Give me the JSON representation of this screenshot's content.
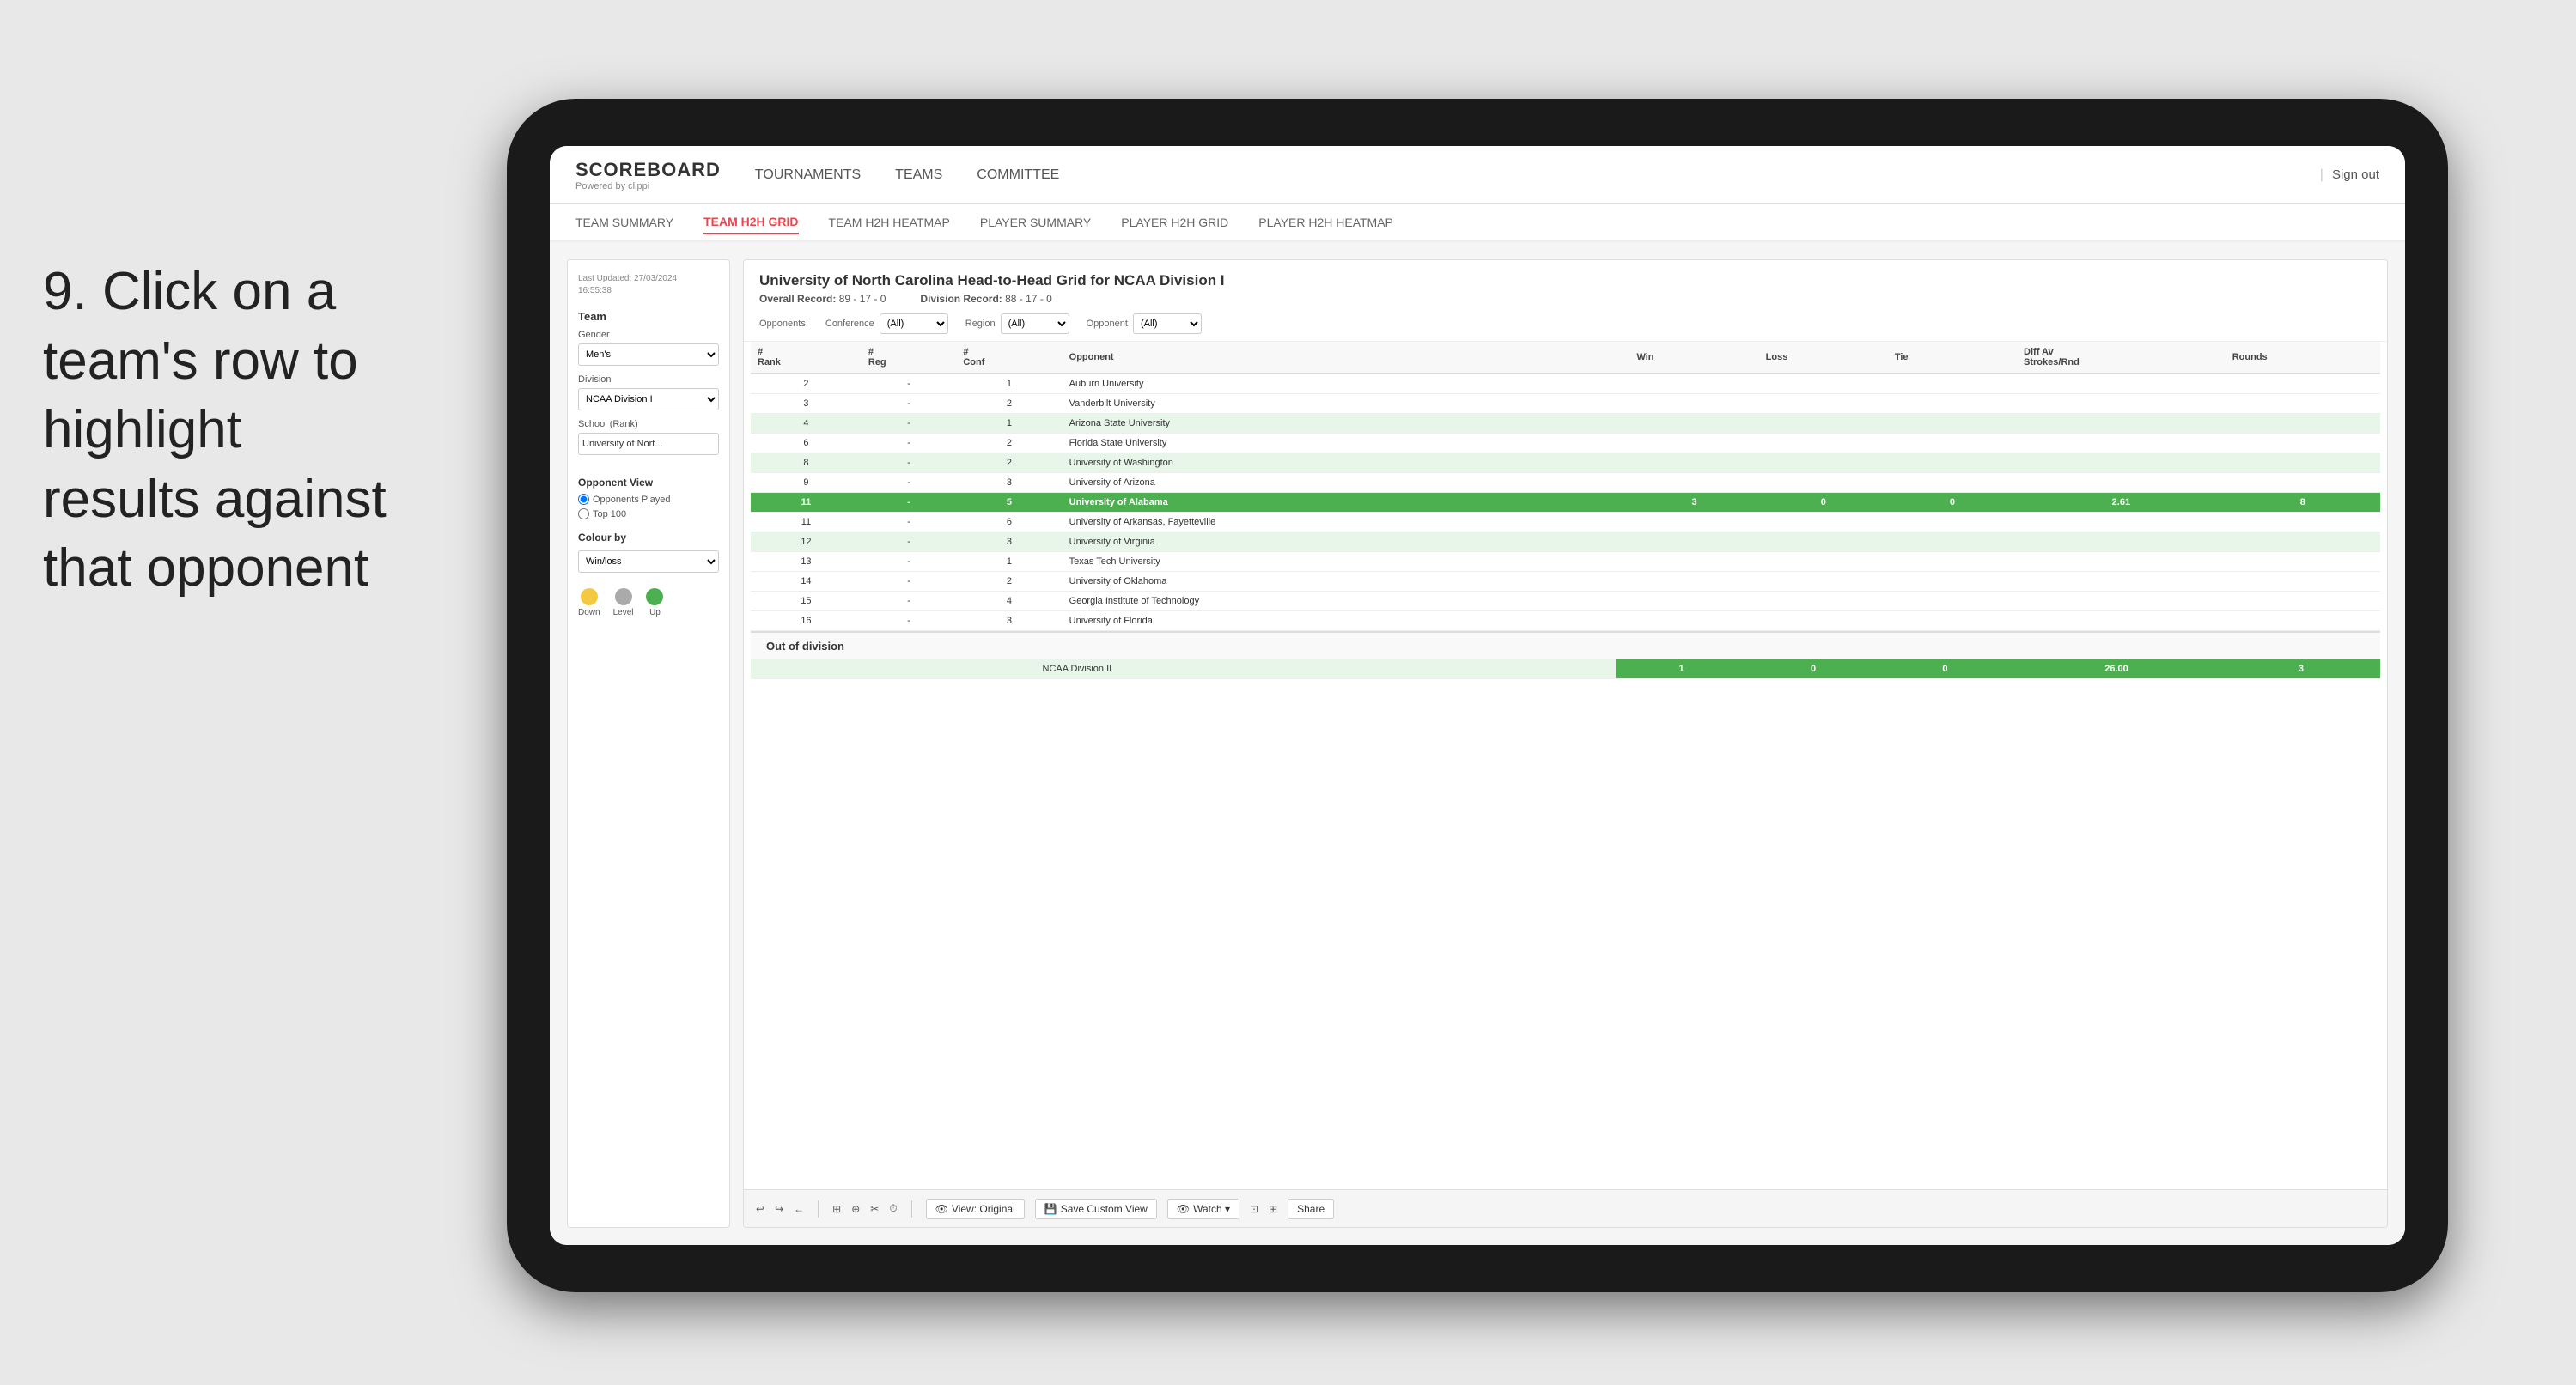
{
  "instruction": {
    "step": "9.",
    "text": "Click on a team's row to highlight results against that opponent"
  },
  "nav": {
    "logo": "SCOREBOARD",
    "logo_sub": "Powered by clippi",
    "items": [
      "TOURNAMENTS",
      "TEAMS",
      "COMMITTEE"
    ],
    "sign_out": "Sign out"
  },
  "sub_nav": {
    "items": [
      "TEAM SUMMARY",
      "TEAM H2H GRID",
      "TEAM H2H HEATMAP",
      "PLAYER SUMMARY",
      "PLAYER H2H GRID",
      "PLAYER H2H HEATMAP"
    ],
    "active": "TEAM H2H GRID"
  },
  "left_panel": {
    "last_updated_label": "Last Updated: 27/03/2024",
    "last_updated_time": "16:55:38",
    "team_label": "Team",
    "gender_label": "Gender",
    "gender_value": "Men's",
    "division_label": "Division",
    "division_value": "NCAA Division I",
    "school_label": "School (Rank)",
    "school_value": "University of Nort...",
    "opponent_view_title": "Opponent View",
    "radio1": "Opponents Played",
    "radio2": "Top 100",
    "colour_by_title": "Colour by",
    "colour_by_value": "Win/loss",
    "legend": [
      {
        "label": "Down",
        "color": "#f5c842"
      },
      {
        "label": "Level",
        "color": "#aaaaaa"
      },
      {
        "label": "Up",
        "color": "#4caf50"
      }
    ]
  },
  "grid": {
    "title": "University of North Carolina Head-to-Head Grid for NCAA Division I",
    "overall_record_label": "Overall Record:",
    "overall_record": "89 - 17 - 0",
    "division_record_label": "Division Record:",
    "division_record": "88 - 17 - 0",
    "filters": {
      "opponents_label": "Opponents:",
      "conference_label": "Conference",
      "conference_value": "(All)",
      "region_label": "Region",
      "region_value": "(All)",
      "opponent_label": "Opponent",
      "opponent_value": "(All)"
    },
    "columns": [
      "#\nRank",
      "#\nReg",
      "#\nConf",
      "Opponent",
      "Win",
      "Loss",
      "Tie",
      "Diff Av\nStrokes/Rnd",
      "Rounds"
    ],
    "rows": [
      {
        "rank": "2",
        "reg": "-",
        "conf": "1",
        "opponent": "Auburn University",
        "win": "",
        "loss": "",
        "tie": "",
        "diff": "",
        "rounds": "",
        "highlight": "none"
      },
      {
        "rank": "3",
        "reg": "-",
        "conf": "2",
        "opponent": "Vanderbilt University",
        "win": "",
        "loss": "",
        "tie": "",
        "diff": "",
        "rounds": "",
        "highlight": "none"
      },
      {
        "rank": "4",
        "reg": "-",
        "conf": "1",
        "opponent": "Arizona State University",
        "win": "",
        "loss": "",
        "tie": "",
        "diff": "",
        "rounds": "",
        "highlight": "light-green"
      },
      {
        "rank": "6",
        "reg": "-",
        "conf": "2",
        "opponent": "Florida State University",
        "win": "",
        "loss": "",
        "tie": "",
        "diff": "",
        "rounds": "",
        "highlight": "none"
      },
      {
        "rank": "8",
        "reg": "-",
        "conf": "2",
        "opponent": "University of Washington",
        "win": "",
        "loss": "",
        "tie": "",
        "diff": "",
        "rounds": "",
        "highlight": "light-green"
      },
      {
        "rank": "9",
        "reg": "-",
        "conf": "3",
        "opponent": "University of Arizona",
        "win": "",
        "loss": "",
        "tie": "",
        "diff": "",
        "rounds": "",
        "highlight": "none"
      },
      {
        "rank": "11",
        "reg": "-",
        "conf": "5",
        "opponent": "University of Alabama",
        "win": "3",
        "loss": "0",
        "tie": "0",
        "diff": "2.61",
        "rounds": "8",
        "highlight": "selected"
      },
      {
        "rank": "11",
        "reg": "-",
        "conf": "6",
        "opponent": "University of Arkansas, Fayetteville",
        "win": "",
        "loss": "",
        "tie": "",
        "diff": "",
        "rounds": "",
        "highlight": "none"
      },
      {
        "rank": "12",
        "reg": "-",
        "conf": "3",
        "opponent": "University of Virginia",
        "win": "",
        "loss": "",
        "tie": "",
        "diff": "",
        "rounds": "",
        "highlight": "light-green"
      },
      {
        "rank": "13",
        "reg": "-",
        "conf": "1",
        "opponent": "Texas Tech University",
        "win": "",
        "loss": "",
        "tie": "",
        "diff": "",
        "rounds": "",
        "highlight": "none"
      },
      {
        "rank": "14",
        "reg": "-",
        "conf": "2",
        "opponent": "University of Oklahoma",
        "win": "",
        "loss": "",
        "tie": "",
        "diff": "",
        "rounds": "",
        "highlight": "none"
      },
      {
        "rank": "15",
        "reg": "-",
        "conf": "4",
        "opponent": "Georgia Institute of Technology",
        "win": "",
        "loss": "",
        "tie": "",
        "diff": "",
        "rounds": "",
        "highlight": "none"
      },
      {
        "rank": "16",
        "reg": "-",
        "conf": "3",
        "opponent": "University of Florida",
        "win": "",
        "loss": "",
        "tie": "",
        "diff": "",
        "rounds": "",
        "highlight": "none"
      }
    ],
    "out_of_division_label": "Out of division",
    "out_of_division_row": {
      "label": "NCAA Division II",
      "win": "1",
      "loss": "0",
      "tie": "0",
      "diff": "26.00",
      "rounds": "3"
    }
  },
  "toolbar": {
    "undo": "↩",
    "redo": "↪",
    "back": "←",
    "view_original": "View: Original",
    "save_custom": "Save Custom View",
    "watch": "Watch ▾",
    "share": "Share"
  },
  "colors": {
    "active_tab": "#e8454e",
    "selected_row": "#4caf50",
    "light_green_row": "#e8f5e9",
    "out_div_row": "#e8f5e9",
    "logo_color": "#333"
  }
}
